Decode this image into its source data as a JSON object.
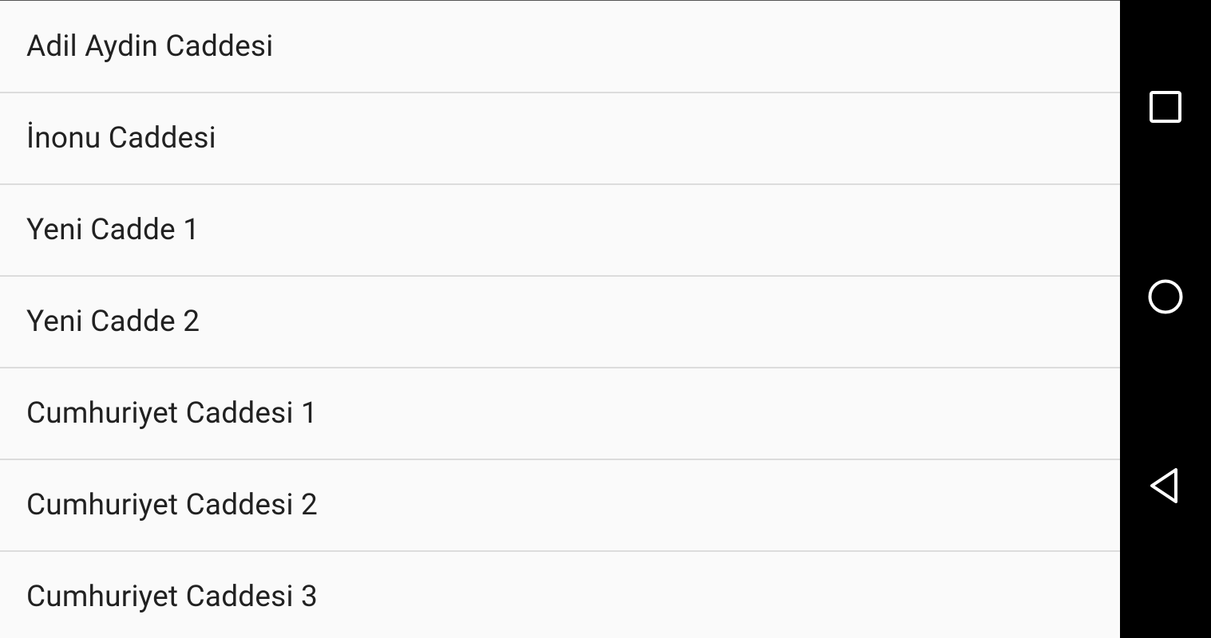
{
  "streets": [
    "Adil Aydin Caddesi",
    "İnonu Caddesi",
    "Yeni Cadde 1",
    "Yeni Cadde 2",
    "Cumhuriyet Caddesi 1",
    "Cumhuriyet Caddesi 2",
    "Cumhuriyet Caddesi 3"
  ],
  "nav_bar": {
    "buttons": [
      {
        "icon": "recents-square-icon"
      },
      {
        "icon": "home-circle-icon"
      },
      {
        "icon": "back-triangle-icon"
      }
    ]
  },
  "colors": {
    "list_background": "#fafafa",
    "divider": "#dcdcdc",
    "text": "#212121",
    "nav_bar_background": "#000000",
    "nav_icon": "#ffffff"
  }
}
